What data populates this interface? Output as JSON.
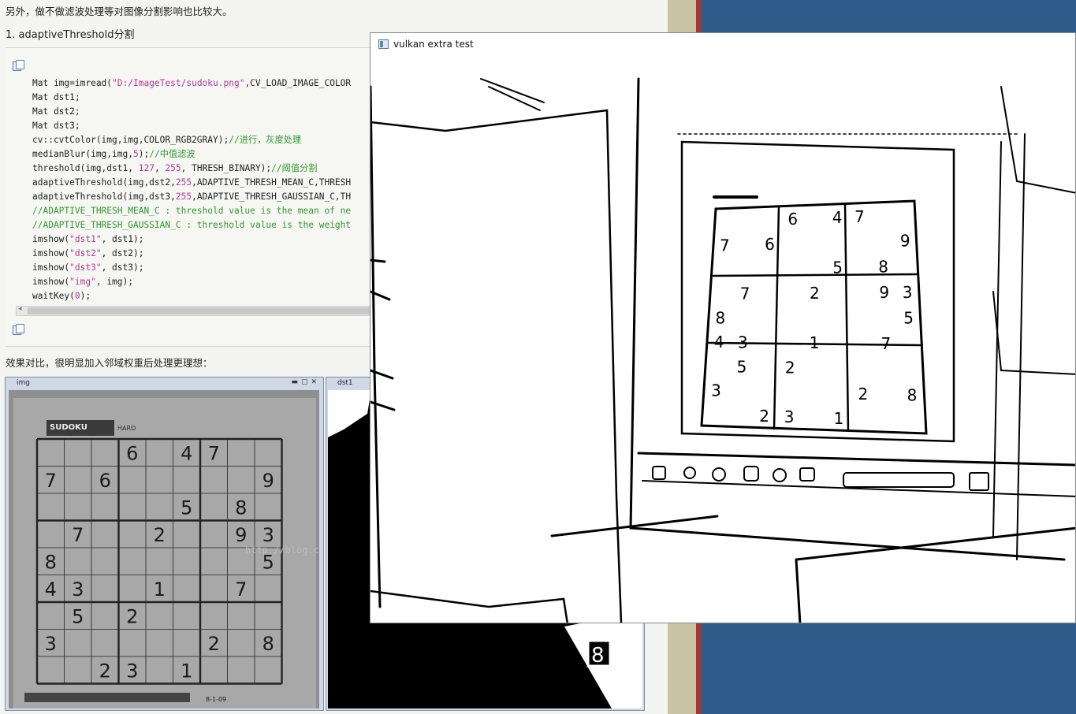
{
  "article": {
    "intro_line": "另外，做不做滤波处理等对图像分割影响也比较大。",
    "section_heading": "1. adaptiveThreshold分割",
    "outro_line": "效果对比，很明显加入邻域权重后处理更理想："
  },
  "code_lines": [
    {
      "segs": [
        {
          "t": "Mat img=imread("
        },
        {
          "t": "\"D:/ImageTest/sudoku.png\"",
          "k": "s"
        },
        {
          "t": ",CV_LOAD_IMAGE_COLOR"
        }
      ]
    },
    {
      "segs": [
        {
          "t": "Mat dst1;"
        }
      ]
    },
    {
      "segs": [
        {
          "t": "Mat dst2;"
        }
      ]
    },
    {
      "segs": [
        {
          "t": "Mat dst3;"
        }
      ]
    },
    {
      "segs": [
        {
          "t": "cv::cvtColor(img,img,COLOR_RGB2GRAY);"
        },
        {
          "t": "//进行，灰度处理",
          "k": "c"
        }
      ]
    },
    {
      "segs": [
        {
          "t": "medianBlur(img,img,"
        },
        {
          "t": "5",
          "k": "n"
        },
        {
          "t": ");"
        },
        {
          "t": "//中值滤波",
          "k": "c"
        }
      ]
    },
    {
      "segs": [
        {
          "t": "threshold(img,dst1, "
        },
        {
          "t": "127",
          "k": "n"
        },
        {
          "t": ", "
        },
        {
          "t": "255",
          "k": "n"
        },
        {
          "t": ", THRESH_BINARY);"
        },
        {
          "t": "//阈值分割",
          "k": "c"
        }
      ]
    },
    {
      "segs": [
        {
          "t": "adaptiveThreshold(img,dst2,"
        },
        {
          "t": "255",
          "k": "n"
        },
        {
          "t": ",ADAPTIVE_THRESH_MEAN_C,THRESH"
        }
      ]
    },
    {
      "segs": [
        {
          "t": "adaptiveThreshold(img,dst3,"
        },
        {
          "t": "255",
          "k": "n"
        },
        {
          "t": ",ADAPTIVE_THRESH_GAUSSIAN_C,TH"
        }
      ]
    },
    {
      "segs": [
        {
          "t": "//ADAPTIVE_THRESH_MEAN_C : threshold value is the mean of ne",
          "k": "c"
        }
      ]
    },
    {
      "segs": [
        {
          "t": "//ADAPTIVE_THRESH_GAUSSIAN_C : threshold value is the weight",
          "k": "c"
        }
      ]
    },
    {
      "segs": [
        {
          "t": "imshow("
        },
        {
          "t": "\"dst1\"",
          "k": "s"
        },
        {
          "t": ", dst1);"
        }
      ]
    },
    {
      "segs": [
        {
          "t": "imshow("
        },
        {
          "t": "\"dst2\"",
          "k": "s"
        },
        {
          "t": ", dst2);"
        }
      ]
    },
    {
      "segs": [
        {
          "t": "imshow("
        },
        {
          "t": "\"dst3\"",
          "k": "s"
        },
        {
          "t": ", dst3);"
        }
      ]
    },
    {
      "segs": [
        {
          "t": "imshow("
        },
        {
          "t": "\"img\"",
          "k": "s"
        },
        {
          "t": ", img);"
        }
      ]
    },
    {
      "segs": [
        {
          "t": "waitKey("
        },
        {
          "t": "0",
          "k": "n"
        },
        {
          "t": ");"
        }
      ]
    }
  ],
  "windows": {
    "img_title": "img",
    "dst1_title": "dst1",
    "vulkan_title": "vulkan extra test"
  },
  "sudoku": {
    "header": "SUDOKU",
    "difficulty": "HARD",
    "stamp": "8-1-09",
    "watermark": "http://blog.csdn.net/ab",
    "grid": [
      [
        "",
        "",
        "",
        "6",
        "",
        "4",
        "7",
        "",
        ""
      ],
      [
        "7",
        "",
        "6",
        "",
        "",
        "",
        "",
        "",
        "9"
      ],
      [
        "",
        "",
        "",
        "",
        "",
        "5",
        "",
        "8",
        ""
      ],
      [
        "",
        "7",
        "",
        "",
        "2",
        "",
        "",
        "9",
        "3"
      ],
      [
        "8",
        "",
        "",
        "",
        "",
        "",
        "",
        "",
        "5"
      ],
      [
        "4",
        "3",
        "",
        "",
        "1",
        "",
        "",
        "7",
        ""
      ],
      [
        "",
        "5",
        "",
        "2",
        "",
        "",
        "",
        "",
        ""
      ],
      [
        "3",
        "",
        "",
        "",
        "",
        "",
        "2",
        "",
        "8"
      ],
      [
        "",
        "",
        "2",
        "3",
        "",
        "1",
        "",
        "",
        ""
      ]
    ]
  },
  "colors": {
    "page_bg": "#f4f4f2",
    "desktop_blue": "#2d5c8b",
    "code_comment": "#2e9a2e",
    "code_string": "#b53a9b"
  }
}
